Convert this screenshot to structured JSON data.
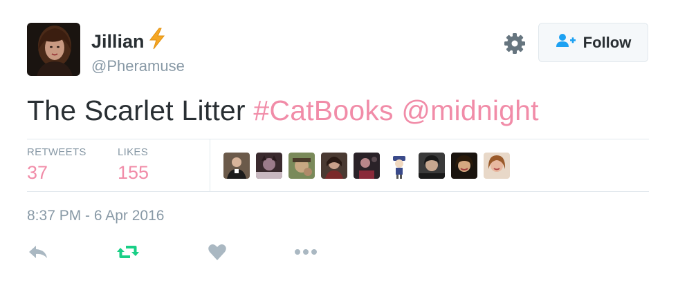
{
  "user": {
    "display_name": "Jillian",
    "handle": "@Pheramuse",
    "name_emoji": "lightning-icon"
  },
  "header": {
    "follow_label": "Follow",
    "settings_icon": "gear-icon"
  },
  "tweet": {
    "text": "The Scarlet Litter",
    "hashtag": "#CatBooks",
    "mention": "@midnight"
  },
  "stats": {
    "retweets_label": "RETWEETS",
    "retweets_value": "37",
    "likes_label": "LIKES",
    "likes_value": "155"
  },
  "timestamp": "8:37 PM - 6 Apr 2016",
  "actions": [
    "reply-icon",
    "retweet-icon",
    "like-icon",
    "more-icon"
  ],
  "colors": {
    "link": "#f18ca8",
    "retweet_active": "#19cf86",
    "muted": "#8899a6",
    "follow_icon": "#1da1f2",
    "lightning": "#f5a623"
  }
}
